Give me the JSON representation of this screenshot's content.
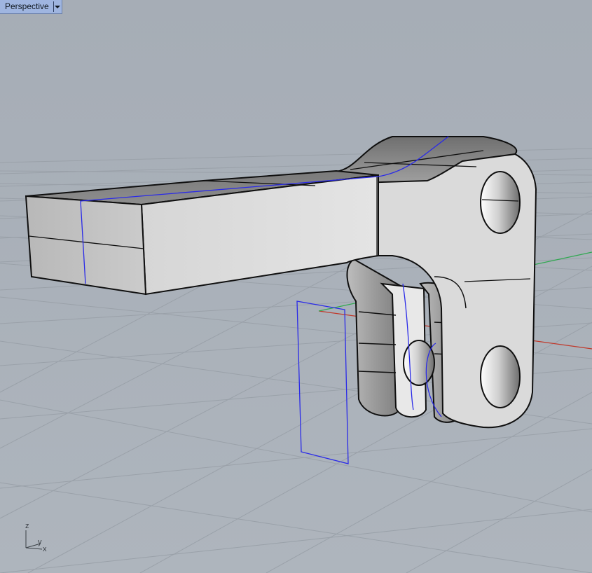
{
  "viewport": {
    "title": "Perspective",
    "menu_icon": "dropdown-arrow-icon",
    "background_color": "#a9b0b9",
    "grid_color": "#99a0a8",
    "x_axis_color": "#c0392b",
    "y_axis_color": "#2fa84f",
    "curve_color": "#2a2ae8",
    "edge_color": "#0f0f0f",
    "surface_color": "#dcdcdc"
  },
  "axis_widget": {
    "z_label": "z",
    "y_label": "y",
    "x_label": "x"
  }
}
